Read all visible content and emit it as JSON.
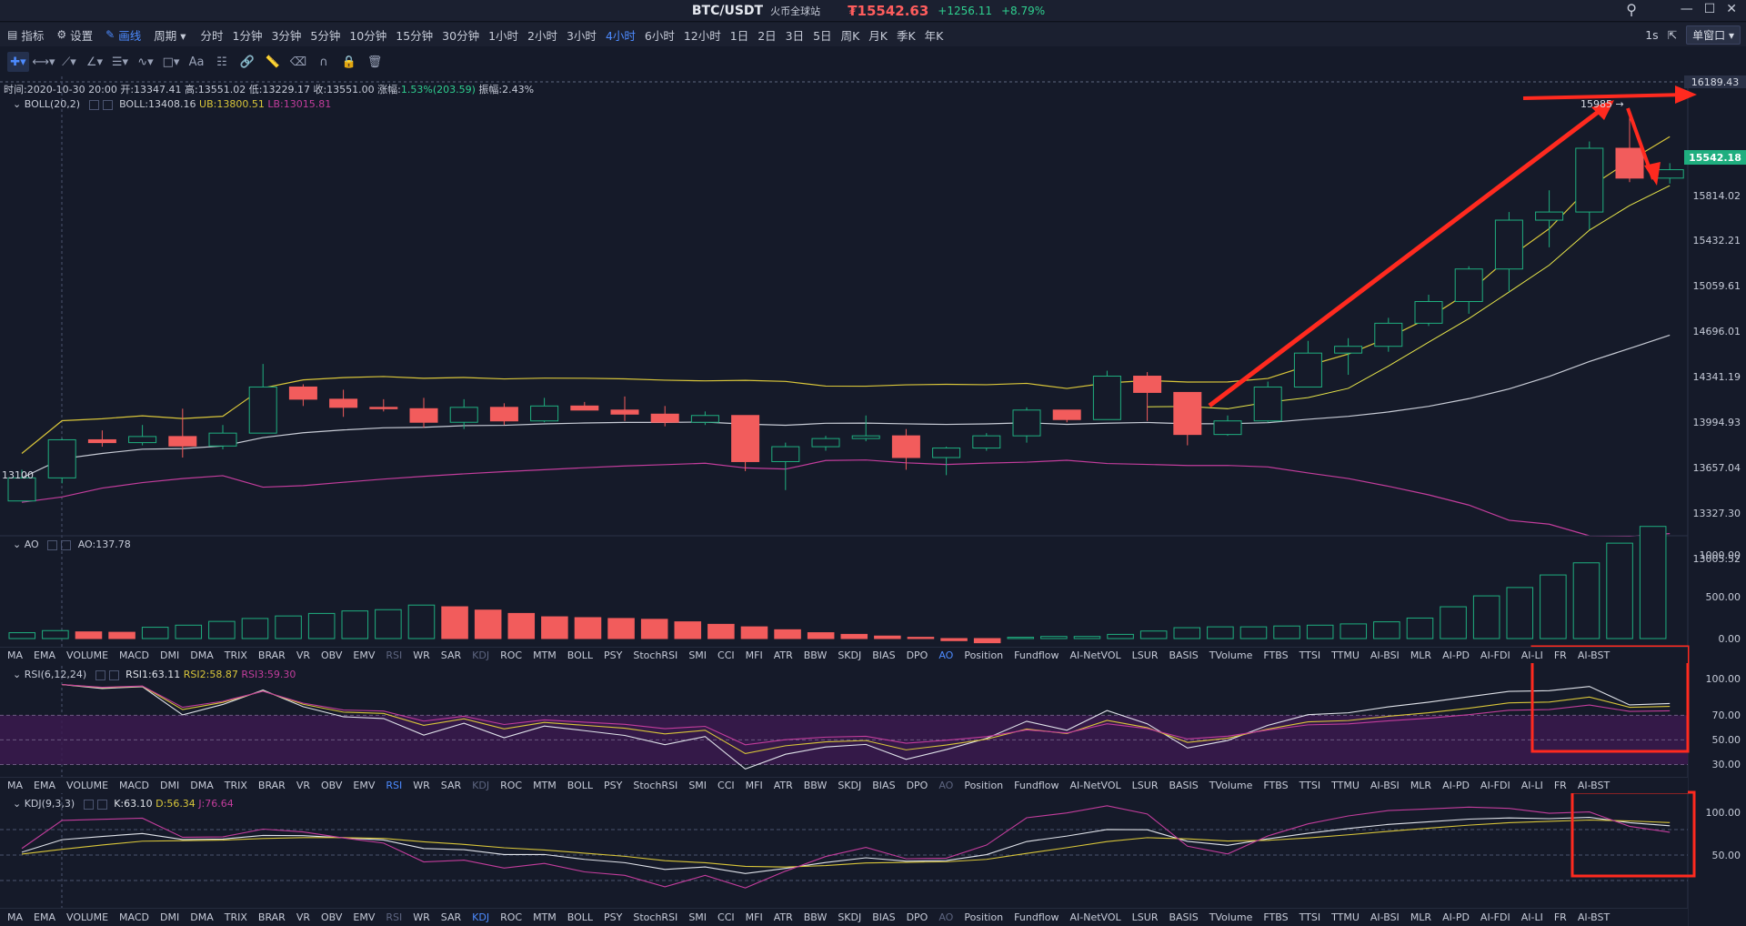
{
  "titlebar": {
    "pair": "BTC/USDT",
    "exchange": "火币全球站",
    "price": "₮15542.63",
    "change_abs": "+1256.11",
    "change_pct": "+8.79%",
    "window_controls": [
      "—",
      "☐",
      "✕"
    ]
  },
  "toolbar": {
    "indicator_label": "指标",
    "settings_label": "设置",
    "draw_label": "画线",
    "period_label": "周期",
    "periods": [
      "分时",
      "1分钟",
      "3分钟",
      "5分钟",
      "10分钟",
      "15分钟",
      "30分钟",
      "1小时",
      "2小时",
      "3小时",
      "4小时",
      "6小时",
      "12小时",
      "1日",
      "2日",
      "3日",
      "5日",
      "周K",
      "月K",
      "季K",
      "年K"
    ],
    "active_period": "4小时",
    "interval": "1s",
    "single_window": "单窗口"
  },
  "info_line": {
    "time": "时间:2020-10-30 20:00",
    "open": "开:13347.41",
    "high": "高:13551.02",
    "low": "低:13229.17",
    "close": "收:13551.00",
    "change": "涨幅:",
    "change_val": "1.53%(203.59)",
    "amplitude": "振幅:2.43%"
  },
  "boll": {
    "label": "BOLL(20,2)",
    "mid": "BOLL:13408.16",
    "ub": "UB:13800.51",
    "lb": "LB:13015.81"
  },
  "ao": {
    "label": "AO",
    "value": "AO:137.78"
  },
  "rsi": {
    "label": "RSI(6,12,24)",
    "rsi1": "RSI1:63.11",
    "rsi2": "RSI2:58.87",
    "rsi3": "RSI3:59.30"
  },
  "kdj": {
    "label": "KDJ(9,3,3)",
    "k": "K:63.10",
    "d": "D:56.34",
    "j": "J:76.64"
  },
  "indicator_tabs": [
    "MA",
    "EMA",
    "VOLUME",
    "MACD",
    "DMI",
    "DMA",
    "TRIX",
    "BRAR",
    "VR",
    "OBV",
    "EMV",
    "RSI",
    "WR",
    "SAR",
    "KDJ",
    "ROC",
    "MTM",
    "BOLL",
    "PSY",
    "StochRSI",
    "SMI",
    "CCI",
    "MFI",
    "ATR",
    "BBW",
    "SKDJ",
    "BIAS",
    "DPO",
    "AO",
    "Position",
    "Fundflow",
    "AI-NetVOL",
    "LSUR",
    "BASIS",
    "TVolume",
    "FTBS",
    "TTSI",
    "TTMU",
    "AI-BSI",
    "MLR",
    "AI-PD",
    "AI-FDI",
    "AI-LI",
    "FR",
    "AI-BST"
  ],
  "price_axis": [
    "16189.43",
    "15814.02",
    "15432.21",
    "15059.61",
    "14696.01",
    "14341.19",
    "13994.93",
    "13657.04",
    "13327.30",
    "13005.52"
  ],
  "last_price": "15542.18",
  "annotations": {
    "high_mark": "15985 →",
    "low_mark": "13100"
  },
  "ao_axis": [
    "1000.00",
    "500.00",
    "0.00"
  ],
  "rsi_axis": [
    "100.00",
    "70.00",
    "50.00",
    "30.00"
  ],
  "kdj_axis": [
    "100.00",
    "50.00"
  ],
  "colors": {
    "up": "#1fae7f",
    "down": "#f25c5c",
    "boll_ub": "#d9c63a",
    "boll_mid": "#c8ccd6",
    "boll_lb": "#c23d9c",
    "annotation": "#ff2a1f"
  },
  "chart_data": {
    "type": "candlestick",
    "series_ohlc": [
      [
        13100,
        13330,
        13180,
        13270
      ],
      [
        13270,
        13560,
        13230,
        13551
      ],
      [
        13551,
        13620,
        13500,
        13530
      ],
      [
        13530,
        13660,
        13510,
        13575
      ],
      [
        13575,
        13780,
        13420,
        13505
      ],
      [
        13505,
        13660,
        13480,
        13600
      ],
      [
        13600,
        14110,
        13600,
        13940
      ],
      [
        13940,
        13960,
        13800,
        13850
      ],
      [
        13850,
        13920,
        13720,
        13790
      ],
      [
        13790,
        13850,
        13760,
        13780
      ],
      [
        13780,
        13860,
        13640,
        13680
      ],
      [
        13680,
        13850,
        13630,
        13790
      ],
      [
        13790,
        13820,
        13660,
        13690
      ],
      [
        13690,
        13860,
        13680,
        13800
      ],
      [
        13800,
        13830,
        13780,
        13770
      ],
      [
        13770,
        13870,
        13690,
        13740
      ],
      [
        13740,
        13800,
        13650,
        13680
      ],
      [
        13680,
        13760,
        13660,
        13730
      ],
      [
        13730,
        13730,
        13320,
        13390
      ],
      [
        13390,
        13530,
        13180,
        13500
      ],
      [
        13500,
        13580,
        13470,
        13560
      ],
      [
        13560,
        13730,
        13540,
        13580
      ],
      [
        13580,
        13630,
        13330,
        13420
      ],
      [
        13420,
        13500,
        13290,
        13490
      ],
      [
        13490,
        13600,
        13470,
        13580
      ],
      [
        13580,
        13790,
        13530,
        13770
      ],
      [
        13770,
        13770,
        13680,
        13700
      ],
      [
        13700,
        14060,
        13700,
        14020
      ],
      [
        14020,
        14050,
        13690,
        13900
      ],
      [
        13900,
        13900,
        13510,
        13590
      ],
      [
        13590,
        13730,
        13580,
        13690
      ],
      [
        13690,
        13980,
        13680,
        13940
      ],
      [
        13940,
        14280,
        13940,
        14190
      ],
      [
        14190,
        14300,
        14030,
        14240
      ],
      [
        14240,
        14450,
        14200,
        14410
      ],
      [
        14410,
        14620,
        14390,
        14570
      ],
      [
        14570,
        14830,
        14480,
        14810
      ],
      [
        14810,
        15230,
        14640,
        15170
      ],
      [
        15170,
        15390,
        14970,
        15230
      ],
      [
        15230,
        15750,
        15100,
        15700
      ],
      [
        15700,
        15985,
        15450,
        15480
      ],
      [
        15480,
        15590,
        15440,
        15542
      ]
    ],
    "ao_values": [
      70,
      95,
      80,
      75,
      135,
      160,
      205,
      240,
      270,
      300,
      330,
      345,
      400,
      380,
      340,
      300,
      260,
      250,
      240,
      230,
      200,
      170,
      140,
      105,
      70,
      50,
      30,
      15,
      -25,
      -50,
      15,
      25,
      25,
      50,
      90,
      130,
      140,
      140,
      150,
      160,
      175,
      200,
      245,
      380,
      510,
      610,
      760,
      905,
      1140,
      1340
    ],
    "rsi_axis_ticks": [
      100,
      70,
      50,
      30
    ],
    "kdj_axis_ticks": [
      100,
      50
    ]
  }
}
